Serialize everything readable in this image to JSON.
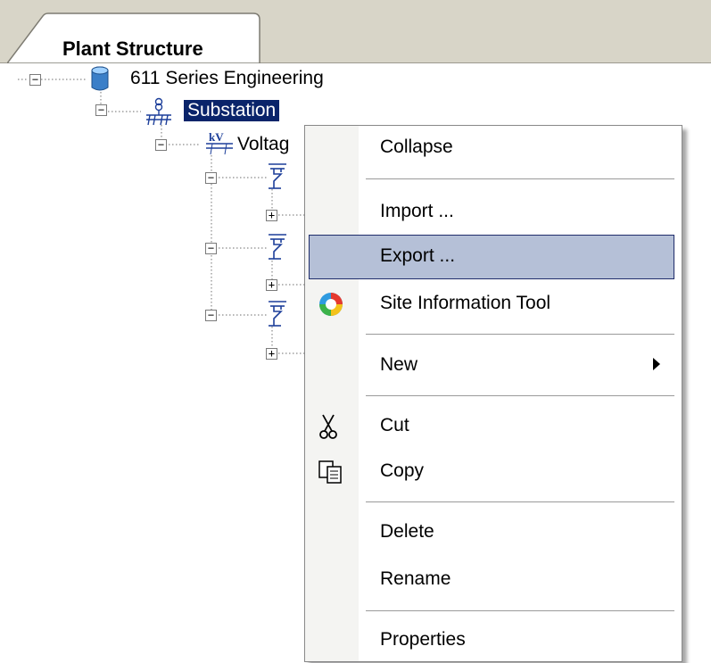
{
  "tab": {
    "title": "Plant Structure"
  },
  "tree": {
    "root": {
      "label": "611 Series Engineering",
      "expander": "−"
    },
    "substation": {
      "label": "Substation",
      "expander": "−"
    },
    "voltage": {
      "label": "Voltag",
      "expander": "−"
    },
    "bays": [
      {
        "expander": "−",
        "child_expander": "+"
      },
      {
        "expander": "−",
        "child_expander": "+"
      },
      {
        "expander": "−",
        "child_expander": "+"
      }
    ]
  },
  "context_menu": {
    "items": {
      "collapse": "Collapse",
      "import": "Import ...",
      "export": "Export ...",
      "site_info": "Site Information Tool",
      "new": "New",
      "cut": "Cut",
      "copy": "Copy",
      "delete": "Delete",
      "rename": "Rename",
      "properties": "Properties"
    },
    "highlighted": "Export ..."
  },
  "colors": {
    "selection": "#0a246a",
    "menu_highlight": "#b5c0d7",
    "menu_highlight_border": "#1f2d6b",
    "tab_bar": "#d8d5c8"
  }
}
